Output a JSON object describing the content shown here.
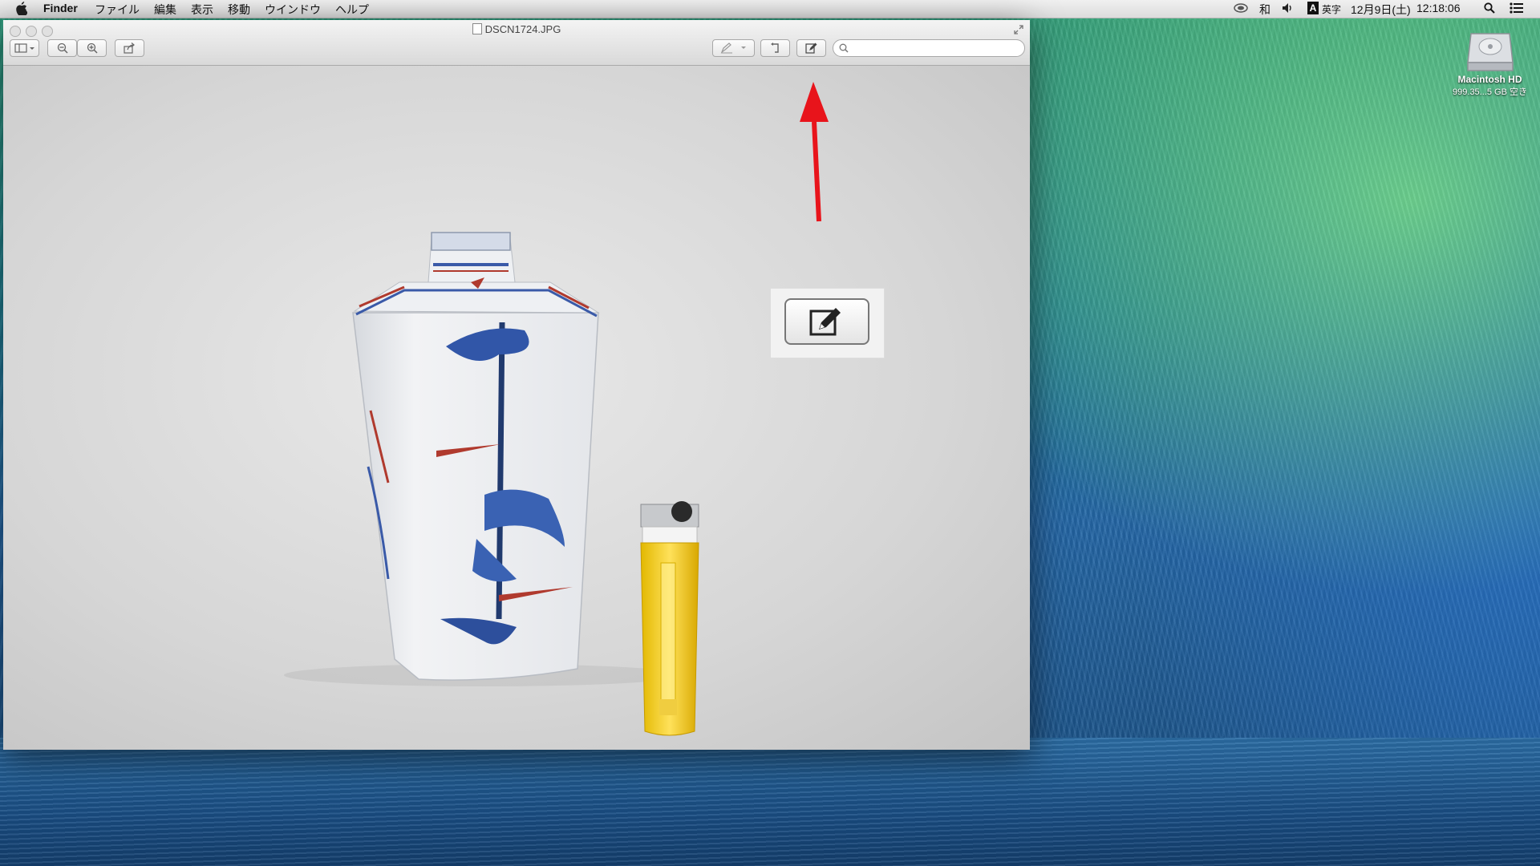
{
  "menubar": {
    "app_name": "Finder",
    "items": [
      "ファイル",
      "編集",
      "表示",
      "移動",
      "ウインドウ",
      "ヘルプ"
    ],
    "status": {
      "input_kana": "和",
      "input_mode_letter": "A",
      "input_mode": "英字",
      "date": "12月9日(土)",
      "time": "12:18:06"
    }
  },
  "window": {
    "title": "DSCN1724.JPG",
    "search_placeholder": ""
  },
  "desktop": {
    "hd_label": "Macintosh HD",
    "hd_sub": "999.35...5 GB 空き"
  },
  "colors": {
    "annotation_arrow": "#e8141b",
    "menubar_bg": "#e6e6e6"
  },
  "icons": [
    "apple-icon",
    "sidebar-toggle-icon",
    "zoom-out-icon",
    "zoom-in-icon",
    "share-icon",
    "markup-pen-icon",
    "rotate-icon",
    "edit-toolbar-icon",
    "search-icon",
    "spotlight-icon",
    "notification-center-icon",
    "hard-drive-icon"
  ]
}
